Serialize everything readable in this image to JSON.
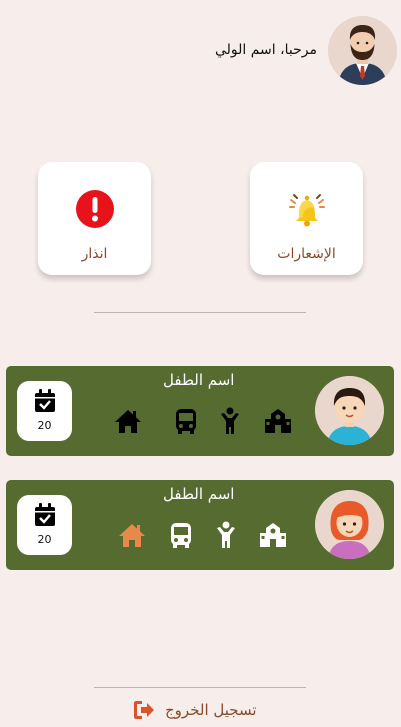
{
  "header": {
    "greeting": "مرحبا، اسم الولي",
    "avatar_icon": "parent-avatar-icon"
  },
  "cards": {
    "notifications": {
      "label": "الإشعارات",
      "icon": "bell-icon"
    },
    "alert": {
      "label": "انذار",
      "icon": "alert-circle-icon"
    }
  },
  "children": [
    {
      "name": "اسم الطفل",
      "avatar_icon": "boy-avatar-icon",
      "date": "20",
      "status_icons": [
        "home-icon",
        "bus-icon",
        "child-icon",
        "school-icon"
      ],
      "active_color": "#000000"
    },
    {
      "name": "اسم الطفل",
      "avatar_icon": "girl-avatar-icon",
      "date": "20",
      "status_icons": [
        "home-icon",
        "bus-icon",
        "child-icon",
        "school-icon"
      ],
      "home_color": "#e6894b",
      "inactive_color": "#ffffff"
    }
  ],
  "logout": {
    "label": "تسجيل الخروج",
    "icon": "logout-icon"
  },
  "colors": {
    "background": "#f7eeec",
    "row_green": "#556b2f",
    "accent_brown": "#8a4a2a",
    "logout_red": "#d9532c"
  }
}
